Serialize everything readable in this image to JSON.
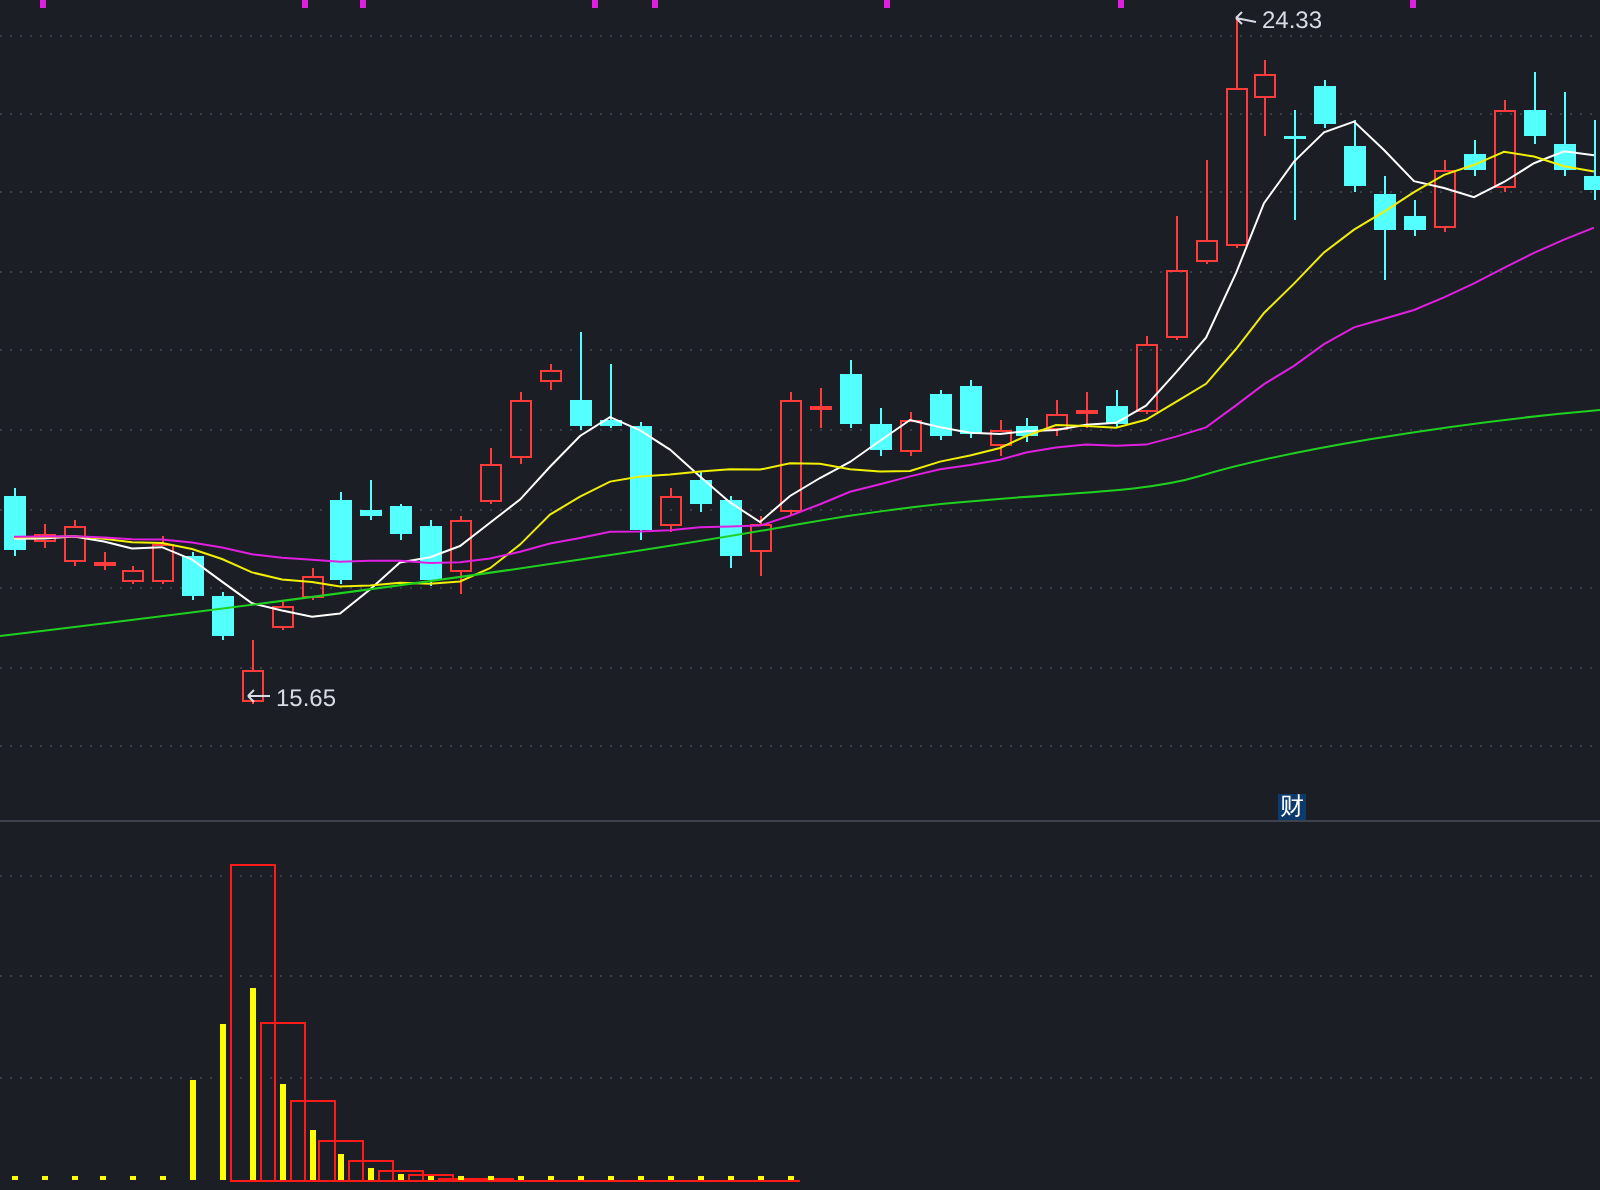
{
  "price_chart": {
    "high_label": "24.33",
    "low_label": "15.65"
  },
  "indicator_panel": {
    "badge": "财"
  }
}
